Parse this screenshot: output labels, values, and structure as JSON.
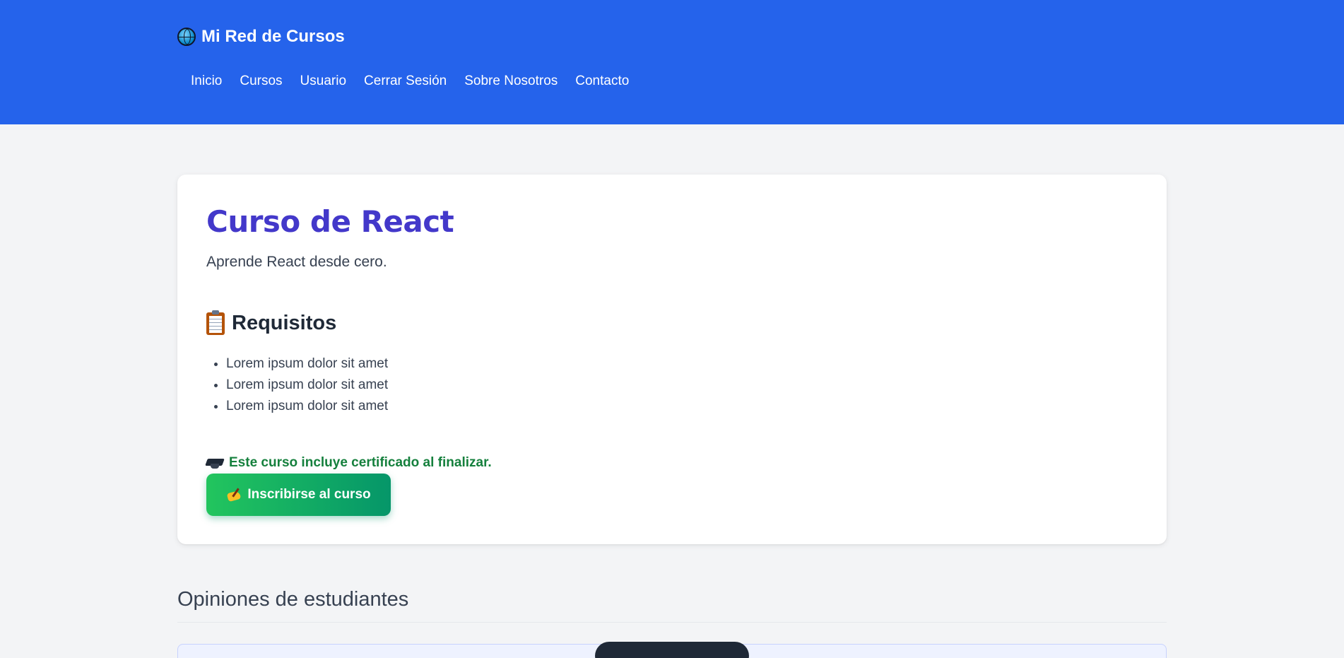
{
  "header": {
    "brand": "Mi Red de Cursos",
    "nav": [
      "Inicio",
      "Cursos",
      "Usuario",
      "Cerrar Sesión",
      "Sobre Nosotros",
      "Contacto"
    ]
  },
  "course": {
    "title": "Curso de React",
    "description": "Aprende React desde cero.",
    "requirements_title": "Requisitos",
    "requirements": [
      "Lorem ipsum dolor sit amet",
      "Lorem ipsum dolor sit amet",
      "Lorem ipsum dolor sit amet"
    ],
    "certificate_note": "Este curso incluye certificado al finalizar.",
    "enroll_label": "Inscribirse al curso"
  },
  "reviews": {
    "title": "Opiniones de estudiantes"
  },
  "colors": {
    "header_bg": "#2563eb",
    "title": "#4338ca",
    "certificate": "#15803d",
    "button_start": "#22c55e",
    "button_end": "#059669"
  }
}
